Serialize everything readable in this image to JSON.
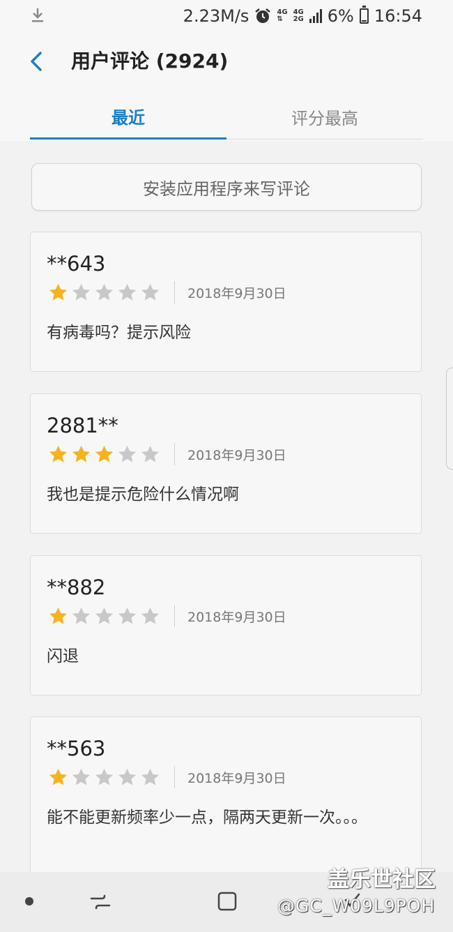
{
  "status_bar": {
    "speed": "2.23M/s",
    "net1": "4G",
    "net2": "4G",
    "net3": "2G",
    "battery": "6%",
    "time": "16:54",
    "icons": [
      "download-icon",
      "alarm-icon",
      "signal-icon",
      "battery-icon"
    ]
  },
  "header": {
    "title": "用户评论 (2924)",
    "tabs": [
      {
        "label": "最近",
        "active": true
      },
      {
        "label": "评分最高",
        "active": false
      }
    ]
  },
  "write_review": {
    "label": "安装应用程序来写评论"
  },
  "reviews": [
    {
      "author": "**643",
      "rating": 1,
      "date": "2018年9月30日",
      "text": "有病毒吗？提示风险"
    },
    {
      "author": "2881**",
      "rating": 3,
      "date": "2018年9月30日",
      "text": "我也是提示危险什么情况啊"
    },
    {
      "author": "**882",
      "rating": 1,
      "date": "2018年9月30日",
      "text": "闪退"
    },
    {
      "author": "**563",
      "rating": 1,
      "date": "2018年9月30日",
      "text": "能不能更新频率少一点，隔两天更新一次。。。"
    }
  ],
  "colors": {
    "accent": "#1c7fc4",
    "star_filled": "#f6b31e",
    "star_empty": "#c8c8c8"
  },
  "watermark": {
    "line1": "盖乐世社区",
    "line2": "@GC_W09L9POH"
  }
}
